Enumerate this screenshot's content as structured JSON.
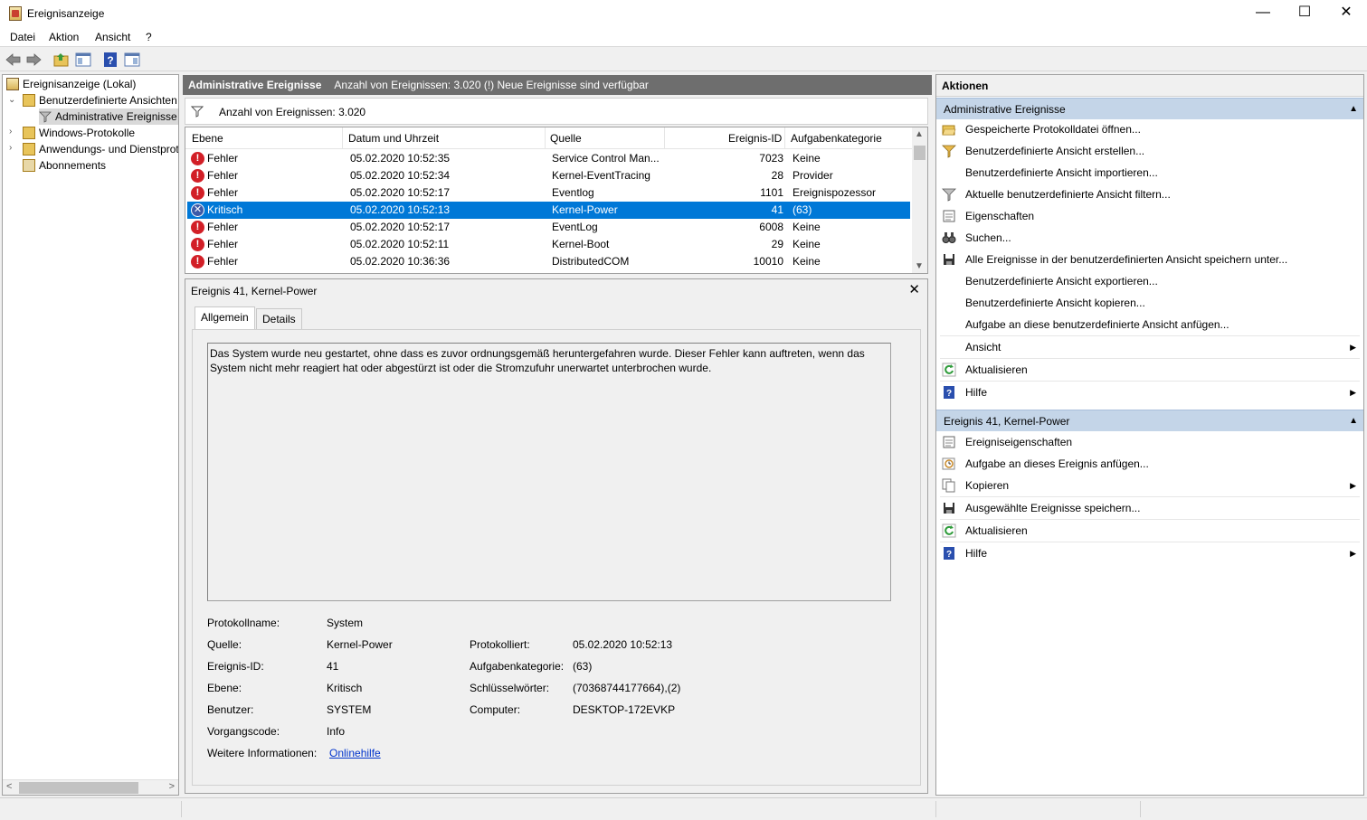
{
  "window": {
    "title": "Ereignisanzeige",
    "minimize_glyph": "—",
    "maximize_glyph": "☐",
    "close_glyph": "✕"
  },
  "menu": [
    "Datei",
    "Aktion",
    "Ansicht",
    "?"
  ],
  "toolbar": {
    "icons": [
      "back-arrow-icon",
      "forward-arrow-icon",
      "folder-up-icon",
      "show-hide-tree-icon",
      "help-icon",
      "show-hide-action-pane-icon"
    ]
  },
  "tree": {
    "root": "Ereignisanzeige (Lokal)",
    "custom_views": "Benutzerdefinierte Ansichten",
    "admin_events": "Administrative Ereignisse",
    "windows_logs": "Windows-Protokolle",
    "app_service_logs": "Anwendungs- und Dienstprotokolle",
    "subscriptions": "Abonnements",
    "scroll_left": "<",
    "scroll_right": ">"
  },
  "center": {
    "header_title": "Administrative Ereignisse",
    "header_info": "Anzahl von Ereignissen: 3.020 (!) Neue Ereignisse sind verfügbar",
    "filter_text": "Anzahl von Ereignissen: 3.020",
    "columns": {
      "level": "Ebene",
      "date": "Datum und Uhrzeit",
      "source": "Quelle",
      "event_id": "Ereignis-ID",
      "task_category": "Aufgabenkategorie"
    },
    "rows": [
      {
        "level": "Fehler",
        "date": "05.02.2020 10:52:35",
        "source": "Service Control Man...",
        "id": "7023",
        "category": "Keine"
      },
      {
        "level": "Fehler",
        "date": "05.02.2020 10:52:34",
        "source": "Kernel-EventTracing",
        "id": "28",
        "category": "Provider"
      },
      {
        "level": "Fehler",
        "date": "05.02.2020 10:52:17",
        "source": "Eventlog",
        "id": "1101",
        "category": "Ereignispozessor"
      },
      {
        "level": "Kritisch",
        "date": "05.02.2020 10:52:13",
        "source": "Kernel-Power",
        "id": "41",
        "category": "(63)"
      },
      {
        "level": "Fehler",
        "date": "05.02.2020 10:52:17",
        "source": "EventLog",
        "id": "6008",
        "category": "Keine"
      },
      {
        "level": "Fehler",
        "date": "05.02.2020 10:52:11",
        "source": "Kernel-Boot",
        "id": "29",
        "category": "Keine"
      },
      {
        "level": "Fehler",
        "date": "05.02.2020 10:36:36",
        "source": "DistributedCOM",
        "id": "10010",
        "category": "Keine"
      }
    ],
    "selected_row": 3,
    "level_glyphs": {
      "error": "!",
      "critical": "✕"
    }
  },
  "detail": {
    "title": "Ereignis 41, Kernel-Power",
    "close_glyph": "✕",
    "tabs": [
      "Allgemein",
      "Details"
    ],
    "description": "Das System wurde neu gestartet, ohne dass es zuvor ordnungsgemäß heruntergefahren wurde. Dieser Fehler kann auftreten, wenn das System nicht mehr reagiert hat oder abgestürzt ist oder die Stromzufuhr unerwartet unterbrochen wurde.",
    "fields": {
      "log_name_label": "Protokollname:",
      "log_name": "System",
      "source_label": "Quelle:",
      "source": "Kernel-Power",
      "logged_label": "Protokolliert:",
      "logged": "05.02.2020 10:52:13",
      "event_id_label": "Ereignis-ID:",
      "event_id": "41",
      "task_category_label": "Aufgabenkategorie:",
      "task_category": "(63)",
      "level_label": "Ebene:",
      "level": "Kritisch",
      "keywords_label": "Schlüsselwörter:",
      "keywords": "(70368744177664),(2)",
      "user_label": "Benutzer:",
      "user": "SYSTEM",
      "computer_label": "Computer:",
      "computer": "DESKTOP-172EVKP",
      "opcode_label": "Vorgangscode:",
      "opcode": "Info",
      "more_info_label": "Weitere Informationen:",
      "more_info_link": "Onlinehilfe"
    }
  },
  "actions": {
    "header": "Aktionen",
    "section1": {
      "title": "Administrative Ereignisse",
      "items": [
        {
          "label": "Gespeicherte Protokolldatei öffnen...",
          "icon": "open-folder-icon"
        },
        {
          "label": "Benutzerdefinierte Ansicht erstellen...",
          "icon": "filter-create-icon"
        },
        {
          "label": "Benutzerdefinierte Ansicht importieren...",
          "icon": ""
        },
        {
          "label": "Aktuelle benutzerdefinierte Ansicht filtern...",
          "icon": "filter-icon"
        },
        {
          "label": "Eigenschaften",
          "icon": "properties-icon"
        },
        {
          "label": "Suchen...",
          "icon": "binoculars-icon"
        },
        {
          "label": "Alle Ereignisse in der benutzerdefinierten Ansicht speichern unter...",
          "icon": "save-icon"
        },
        {
          "label": "Benutzerdefinierte Ansicht exportieren...",
          "icon": ""
        },
        {
          "label": "Benutzerdefinierte Ansicht kopieren...",
          "icon": ""
        },
        {
          "label": "Aufgabe an diese benutzerdefinierte Ansicht anfügen...",
          "icon": ""
        },
        {
          "label": "Ansicht",
          "icon": ""
        },
        {
          "label": "Aktualisieren",
          "icon": "refresh-icon"
        },
        {
          "label": "Hilfe",
          "icon": "help-icon"
        }
      ]
    },
    "section2": {
      "title": "Ereignis 41, Kernel-Power",
      "items": [
        {
          "label": "Ereigniseigenschaften",
          "icon": "properties-icon"
        },
        {
          "label": "Aufgabe an dieses Ereignis anfügen...",
          "icon": "task-clock-icon"
        },
        {
          "label": "Kopieren",
          "icon": "copy-icon"
        },
        {
          "label": "Ausgewählte Ereignisse speichern...",
          "icon": "save-icon"
        },
        {
          "label": "Aktualisieren",
          "icon": "refresh-icon"
        },
        {
          "label": "Hilfe",
          "icon": "help-icon"
        }
      ]
    },
    "collapse_glyph": "▲",
    "submenu_glyph": "▶"
  }
}
